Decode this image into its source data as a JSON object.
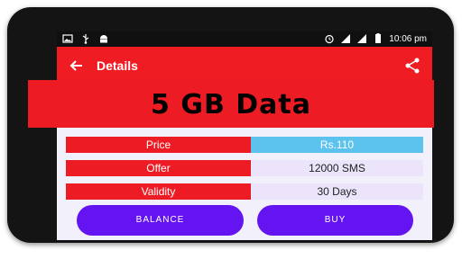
{
  "status_bar": {
    "time": "10:06 pm",
    "left_icons": [
      "image-icon",
      "usb-icon",
      "android-icon"
    ],
    "right_icons": [
      "alarm-icon",
      "signal-icon",
      "signal-icon",
      "battery-icon"
    ]
  },
  "app_bar": {
    "title": "Details",
    "back_icon": "arrow-left-icon",
    "share_icon": "share-icon",
    "color": "#ef1c24"
  },
  "banner": {
    "text": "5 GB Data",
    "color": "#ed1c24"
  },
  "details": [
    {
      "label": "Price",
      "value": "Rs.110"
    },
    {
      "label": "Offer",
      "value": "12000 SMS"
    },
    {
      "label": "Validity",
      "value": "30 Days"
    }
  ],
  "buttons": {
    "balance_label": "BALANCE",
    "buy_label": "BUY",
    "color": "#6414f0"
  }
}
